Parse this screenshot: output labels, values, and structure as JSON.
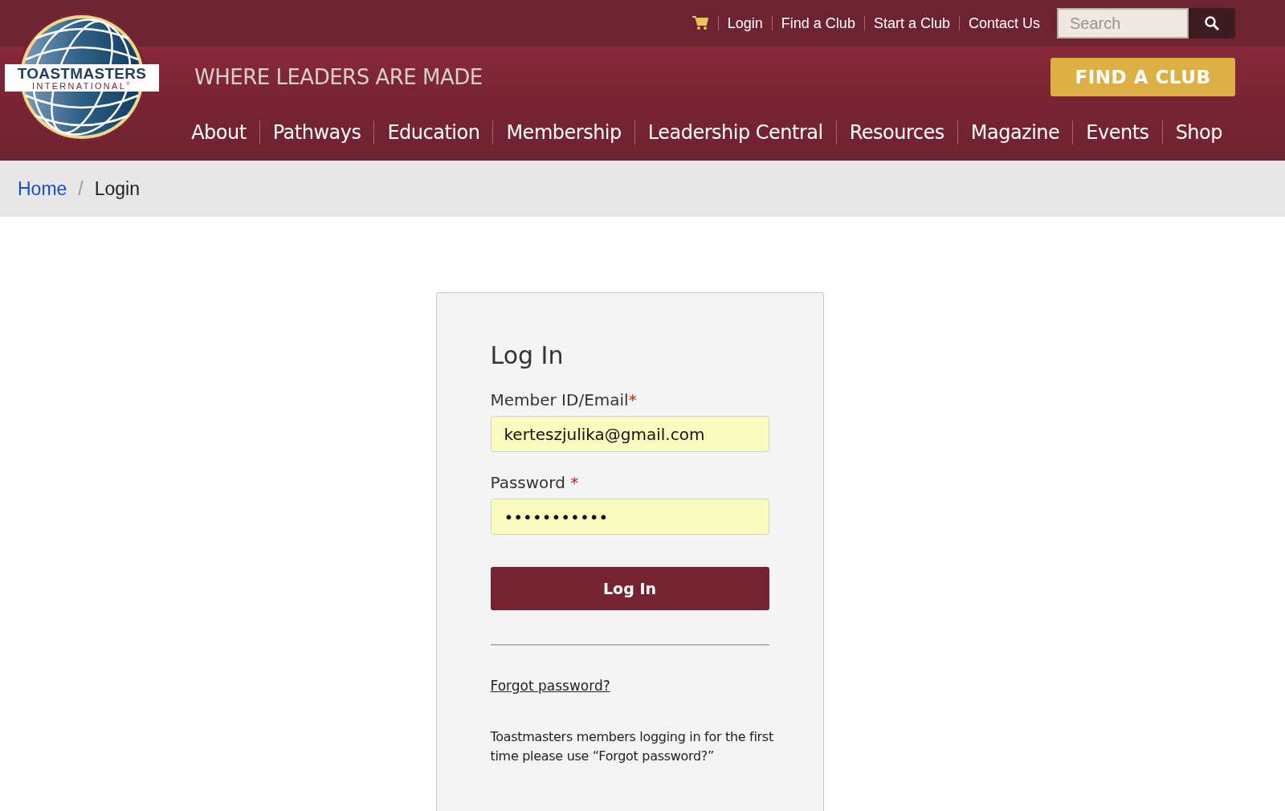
{
  "logo": {
    "name": "TOASTMASTERS",
    "subtitle": "INTERNATIONAL",
    "mark": "®"
  },
  "top_links": [
    {
      "label": "Login"
    },
    {
      "label": "Find a Club"
    },
    {
      "label": "Start a Club"
    },
    {
      "label": "Contact Us"
    }
  ],
  "search": {
    "placeholder": "Search"
  },
  "tagline": "WHERE LEADERS ARE MADE",
  "cta_button": "FIND A CLUB",
  "main_nav": [
    {
      "label": "About"
    },
    {
      "label": "Pathways"
    },
    {
      "label": "Education"
    },
    {
      "label": "Membership"
    },
    {
      "label": "Leadership Central"
    },
    {
      "label": "Resources"
    },
    {
      "label": "Magazine"
    },
    {
      "label": "Events"
    },
    {
      "label": "Shop"
    }
  ],
  "breadcrumb": [
    {
      "label": "Home",
      "link": true
    },
    {
      "label": "Login",
      "link": false
    }
  ],
  "breadcrumb_separator": "/",
  "login_form": {
    "title": "Log In",
    "fields": [
      {
        "label": "Member ID/Email",
        "required_mark": "*",
        "value": "kerteszjulika@gmail.com"
      },
      {
        "label": "Password",
        "required_mark": "*",
        "value": "•••••••••••"
      }
    ],
    "submit": "Log In",
    "forgot_link": "Forgot password?",
    "note": "Toastmasters members logging in for the first time please use “Forgot password?”"
  }
}
